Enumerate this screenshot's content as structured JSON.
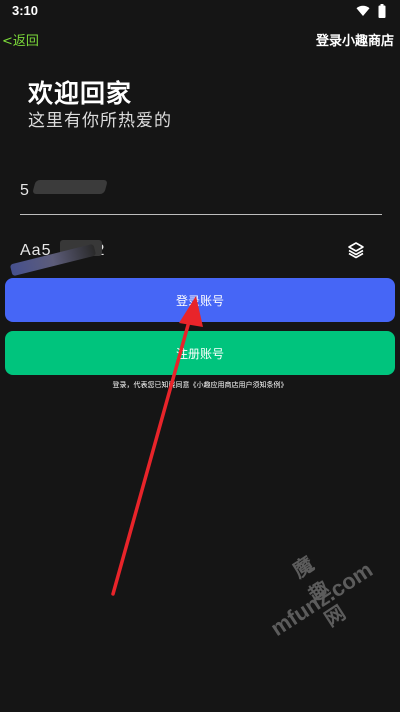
{
  "status_bar": {
    "time": "3:10"
  },
  "top_bar": {
    "back_label": "<返回",
    "right_label": "登录小趣商店"
  },
  "welcome": {
    "title": "欢迎回家",
    "subtitle": "这里有你所热爱的"
  },
  "form": {
    "account_value": "5",
    "password_value": "Aa5",
    "password_suffix": "2"
  },
  "buttons": {
    "login_label": "登录账号",
    "register_label": "注册账号"
  },
  "agreement": {
    "text": "登录，代表您已知晓同意《小趣应用商店用户须知条例》"
  },
  "watermark": {
    "site_name": "魔趣网",
    "url": "mfunz.com"
  },
  "colors": {
    "background": "#151515",
    "back_link": "#7ddc3a",
    "login_button": "#4666f6",
    "register_button": "#00c47d",
    "annotation_arrow": "#e8242a"
  }
}
